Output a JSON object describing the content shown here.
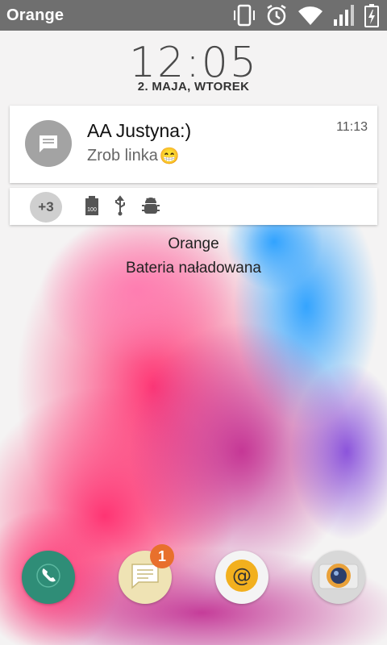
{
  "status_bar": {
    "carrier": "Orange"
  },
  "lock": {
    "time": "12:05",
    "date": "2. MAJA, WTOREK",
    "carrier": "Orange",
    "battery_status": "Bateria naładowana"
  },
  "notification": {
    "title": "AA Justyna:)",
    "text": "Zrob linka",
    "emoji": "😁",
    "time": "11:13"
  },
  "more_notifications": {
    "count": "+3"
  },
  "dock": {
    "messages_badge": "1"
  },
  "icons": {
    "status": [
      "vibrate-icon",
      "alarm-icon",
      "wifi-icon",
      "signal-icon",
      "battery-charging-icon"
    ],
    "row2": [
      "battery-100-icon",
      "usb-icon",
      "android-debug-icon"
    ],
    "dock": [
      "phone-icon",
      "messages-icon",
      "email-icon",
      "camera-icon"
    ]
  },
  "colors": {
    "status_bar": "#6f6f6f",
    "phone": "#2f8d77",
    "badge": "#e8702c"
  }
}
